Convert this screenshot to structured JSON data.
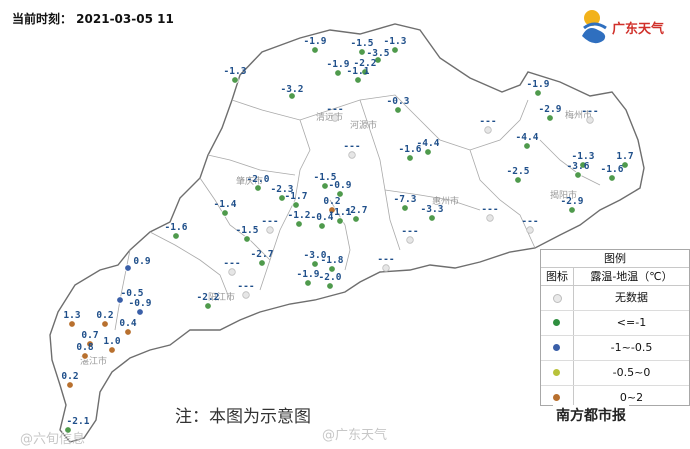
{
  "header": {
    "timestamp": "当前时刻： 2021-03-05 11"
  },
  "brand": {
    "name": "广东天气",
    "icon": "sun-cloud-logo-icon"
  },
  "map": {
    "colors": {
      "land": "#ffffff",
      "border": "#6e6e6e",
      "city_border": "#a9a9a9",
      "sea": "#ffffff"
    },
    "no_data_text": "---",
    "city_names": [
      "清远市",
      "肇庆市",
      "河源市",
      "梅州市",
      "揭阳市",
      "惠州市",
      "阳江市",
      "湛江市"
    ],
    "stations": [
      {
        "label": "-1.9",
        "category": "le_-1"
      },
      {
        "label": "-1.5",
        "category": "le_-1"
      },
      {
        "label": "-1.3",
        "category": "le_-1"
      },
      {
        "label": "-3.5",
        "category": "le_-1"
      },
      {
        "label": "-2.2",
        "category": "le_-1"
      },
      {
        "label": "-1.9",
        "category": "le_-1"
      },
      {
        "label": "-1.1",
        "category": "le_-1"
      },
      {
        "label": "-1.3",
        "category": "le_-1"
      },
      {
        "label": "-3.2",
        "category": "le_-1"
      },
      {
        "label": "-0.3",
        "category": "le_-1"
      },
      {
        "label": "-1.9",
        "category": "le_-1"
      },
      {
        "label": "-2.9",
        "category": "le_-1"
      },
      {
        "label": "-4.4",
        "category": "le_-1"
      },
      {
        "label": "-4.4",
        "category": "le_-1"
      },
      {
        "label": "-1.6",
        "category": "le_-1"
      },
      {
        "label": "-1.3",
        "category": "le_-1"
      },
      {
        "label": "1.7",
        "category": "le_-1"
      },
      {
        "label": "-3.6",
        "category": "le_-1"
      },
      {
        "label": "-2.5",
        "category": "le_-1"
      },
      {
        "label": "-1.6",
        "category": "le_-1"
      },
      {
        "label": "-2.9",
        "category": "le_-1"
      },
      {
        "label": "-2.0",
        "category": "le_-1"
      },
      {
        "label": "-1.5",
        "category": "le_-1"
      },
      {
        "label": "-0.9",
        "category": "le_-1"
      },
      {
        "label": "-2.3",
        "category": "le_-1"
      },
      {
        "label": "-1.7",
        "category": "le_-1"
      },
      {
        "label": "0.2",
        "category": "0_2"
      },
      {
        "label": "-1.4",
        "category": "le_-1"
      },
      {
        "label": "-1.2",
        "category": "le_-1"
      },
      {
        "label": "-0.4",
        "category": "le_-1"
      },
      {
        "label": "-1.1",
        "category": "le_-1"
      },
      {
        "label": "-2.7",
        "category": "le_-1"
      },
      {
        "label": "-7.3",
        "category": "le_-1"
      },
      {
        "label": "-3.3",
        "category": "le_-1"
      },
      {
        "label": "-1.6",
        "category": "le_-1"
      },
      {
        "label": "-1.5",
        "category": "le_-1"
      },
      {
        "label": "-2.7",
        "category": "le_-1"
      },
      {
        "label": "-3.0",
        "category": "le_-1"
      },
      {
        "label": "-1.8",
        "category": "le_-1"
      },
      {
        "label": "-1.9",
        "category": "le_-1"
      },
      {
        "label": "-2.0",
        "category": "le_-1"
      },
      {
        "label": "0.9",
        "category": "-1_-0.5"
      },
      {
        "label": "-0.5",
        "category": "-1_-0.5"
      },
      {
        "label": "-0.9",
        "category": "-1_-0.5"
      },
      {
        "label": "-2.2",
        "category": "le_-1"
      },
      {
        "label": "1.3",
        "category": "0_2"
      },
      {
        "label": "0.2",
        "category": "0_2"
      },
      {
        "label": "0.4",
        "category": "0_2"
      },
      {
        "label": "0.7",
        "category": "0_2"
      },
      {
        "label": "0.8",
        "category": "0_2"
      },
      {
        "label": "1.0",
        "category": "0_2"
      },
      {
        "label": "0.2",
        "category": "0_2"
      },
      {
        "label": "-2.1",
        "category": "le_-1"
      },
      {
        "label": "",
        "category": "no_data"
      },
      {
        "label": "",
        "category": "no_data"
      },
      {
        "label": "",
        "category": "no_data"
      },
      {
        "label": "",
        "category": "no_data"
      },
      {
        "label": "",
        "category": "no_data"
      },
      {
        "label": "",
        "category": "no_data"
      },
      {
        "label": "",
        "category": "no_data"
      },
      {
        "label": "",
        "category": "no_data"
      },
      {
        "label": "",
        "category": "no_data"
      },
      {
        "label": "",
        "category": "no_data"
      },
      {
        "label": "",
        "category": "no_data"
      }
    ]
  },
  "legend": {
    "title": "图例",
    "header_symbol": "图标",
    "header_label": "露温-地温（℃）",
    "items": [
      {
        "label": "无数据",
        "color": "#e9e9e9"
      },
      {
        "label": "<=-1",
        "color": "#2f8f3f"
      },
      {
        "label": "-1~-0.5",
        "color": "#3a5fa8"
      },
      {
        "label": "-0.5~0",
        "color": "#b8c23a"
      },
      {
        "label": "0~2",
        "color": "#b8702e"
      }
    ]
  },
  "note": "注：本图为示意图",
  "watermarks": [
    "@广东天气",
    "@六旬信息"
  ],
  "publisher": "南方都市报"
}
